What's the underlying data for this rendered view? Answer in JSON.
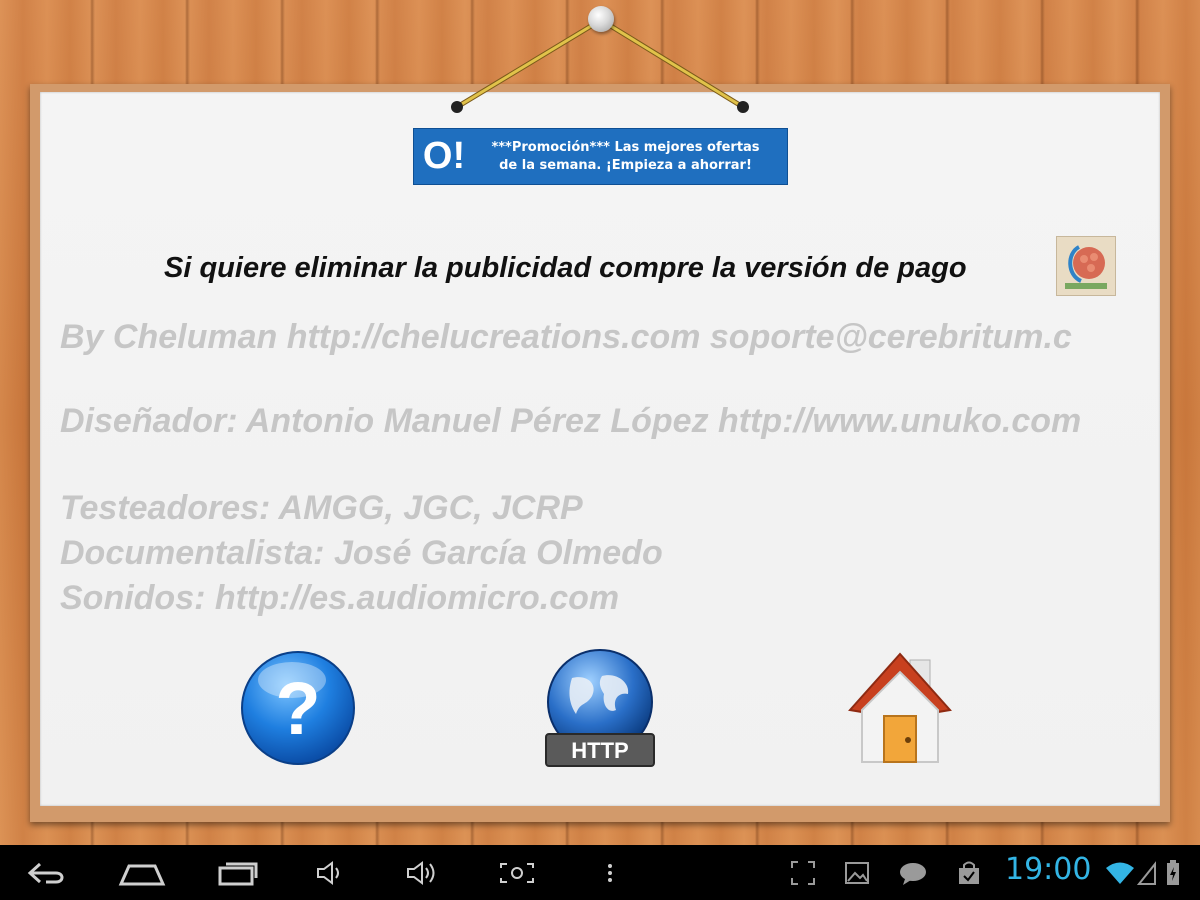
{
  "ad": {
    "logo_text": "O!",
    "text_line1": "***Promoción*** Las mejores ofertas",
    "text_line2": "de la semana. ¡Empieza a ahorrar!"
  },
  "notice": "Si quiere eliminar la publicidad compre la versión de pago",
  "credits": {
    "line1": "By Cheluman  http://chelucreations.com  soporte@cerebritum.c",
    "line2": "Diseñador: Antonio Manuel Pérez López http://www.unuko.com",
    "line3": "Testeadores: AMGG, JGC, JCRP",
    "line4": "Documentalista: José García Olmedo",
    "line5": "Sonidos:  http://es.audiomicro.com"
  },
  "buttons": {
    "help_glyph": "?",
    "http_label": "HTTP"
  },
  "statusbar": {
    "time": "19:00"
  },
  "colors": {
    "accent_blue": "#33b5e5",
    "ad_blue": "#1f6fbf",
    "credit_gray": "#c6c6c6"
  }
}
